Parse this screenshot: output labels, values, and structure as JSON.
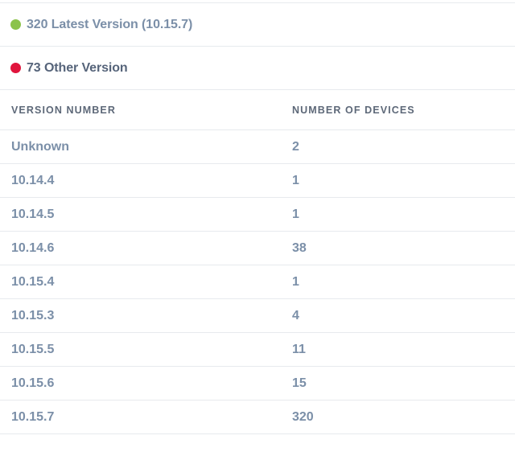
{
  "summary": {
    "latest": {
      "label": "320 Latest Version (10.15.7)",
      "dot_color": "#8bc34a"
    },
    "other": {
      "label": "73 Other Version",
      "dot_color": "#e0143c"
    }
  },
  "table": {
    "headers": [
      "VERSION NUMBER",
      "NUMBER OF DEVICES"
    ],
    "rows": [
      {
        "version": "Unknown",
        "count": "2"
      },
      {
        "version": "10.14.4",
        "count": "1"
      },
      {
        "version": "10.14.5",
        "count": "1"
      },
      {
        "version": "10.14.6",
        "count": "38"
      },
      {
        "version": "10.15.4",
        "count": "1"
      },
      {
        "version": "10.15.3",
        "count": "4"
      },
      {
        "version": "10.15.5",
        "count": "11"
      },
      {
        "version": "10.15.6",
        "count": "15"
      },
      {
        "version": "10.15.7",
        "count": "320"
      }
    ]
  }
}
